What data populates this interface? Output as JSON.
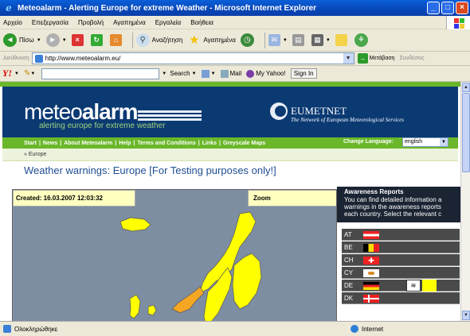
{
  "window": {
    "title": "Meteoalarm - Alerting Europe for extreme Weather - Microsoft Internet Explorer",
    "minimize": "_",
    "maximize": "□",
    "close": "×"
  },
  "menu": [
    "Αρχείο",
    "Επεξεργασία",
    "Προβολή",
    "Αγαπημένα",
    "Εργαλεία",
    "Βοήθεια"
  ],
  "toolbar": {
    "back": "Πίσω",
    "search": "Αναζήτηση",
    "favorites": "Αγαπημένα"
  },
  "address": {
    "label": "Διεύθυνση",
    "url": "http://www.meteoalarm.eu/",
    "go": "Μετάβαση",
    "links": "Συνδέσεις"
  },
  "yahoo": {
    "logo": "Y!",
    "search": "Search",
    "mail": "Mail",
    "my_yahoo": "My Yahoo!",
    "sign_in": "Sign In"
  },
  "site": {
    "logo_light": "meteo",
    "logo_bold": "alarm",
    "tagline": "alerting europe for extreme weather",
    "partner_name": "EUMETNET",
    "partner_sub": "The Network of European Meteorological Services",
    "nav": [
      "Start",
      "News",
      "About Meteoalarm",
      "Help",
      "Terms and Conditions",
      "Links",
      "Greyscale Maps"
    ],
    "change_language": "Change Language:",
    "language": "english",
    "breadcrumb": "» Europe",
    "heading": "Weather warnings: Europe [For Testing purposes only!]",
    "created": "Created: 16.03.2007 12:03:32",
    "zoom": "Zoom",
    "awareness_title": "Awareness Reports",
    "awareness_lines": [
      "You can find detailed information a",
      "warnings in the awareness reports",
      "each country. Select the relevant c"
    ],
    "countries": [
      "AT",
      "BE",
      "CH",
      "CY",
      "DE",
      "DK"
    ]
  },
  "status": {
    "left": "Ολοκληρώθηκε",
    "zone": "Internet"
  },
  "colors": {
    "banner": "#0b3a73",
    "green": "#6ab72a",
    "warning_yellow": "#ffff00",
    "warning_orange": "#f5a623",
    "sea": "#7e8ea2"
  }
}
